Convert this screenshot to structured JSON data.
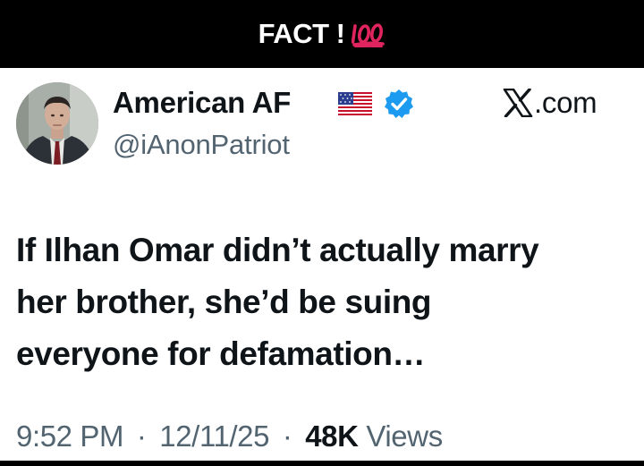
{
  "banner": {
    "text": "FACT !",
    "emoji_icon": "hundred-points-icon",
    "emoji_color": "#e0245e"
  },
  "post": {
    "author": {
      "display_name": "American AF",
      "flag_icon": "us-flag-icon",
      "verified_icon": "verified-badge-icon",
      "verified_color": "#1d9bf0",
      "handle": "@iAnonPatriot"
    },
    "platform": {
      "logo_icon": "x-logo-icon",
      "suffix": ".com"
    },
    "text_lines": [
      "If Ilhan Omar didn’t actually marry",
      "her brother, she’d be suing",
      "everyone for defamation…"
    ],
    "meta": {
      "time": "9:52 PM",
      "separator": "·",
      "date": "12/11/25",
      "views_count": "48K",
      "views_label": "Views"
    }
  }
}
